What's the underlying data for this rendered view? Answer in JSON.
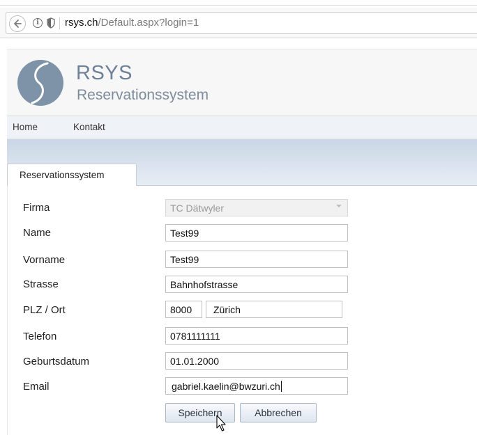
{
  "browser": {
    "url_host": "rsys.ch",
    "url_path": "/Default.aspx?login=1"
  },
  "brand": {
    "name": "RSYS",
    "subtitle": "Reservationssystem"
  },
  "menu": {
    "items": [
      {
        "label": "Home"
      },
      {
        "label": "Kontakt"
      }
    ]
  },
  "tab": {
    "label": "Reservationssystem"
  },
  "form": {
    "firma_label": "Firma",
    "firma_value": "TC Dätwyler",
    "name_label": "Name",
    "name_value": "Test99",
    "vorname_label": "Vorname",
    "vorname_value": "Test99",
    "strasse_label": "Strasse",
    "strasse_value": "Bahnhofstrasse",
    "plzort_label": "PLZ / Ort",
    "plz_value": "8000",
    "ort_value": "Zürich",
    "telefon_label": "Telefon",
    "telefon_value": "0781111111",
    "geburtsdatum_label": "Geburtsdatum",
    "geburtsdatum_value": "01.01.2000",
    "email_label": "Email",
    "email_value": "gabriel.kaelin@bwzuri.ch"
  },
  "buttons": {
    "save_label": "Speichern",
    "cancel_label": "Abbrechen"
  },
  "colors": {
    "brand_text": "#6f8196",
    "logo_circle": "#7f93a8",
    "menu_bg": "#eff3f8",
    "header_gradient_top": "#c9d6e6"
  },
  "icons": [
    "back-arrow-icon",
    "info-icon",
    "shield-icon",
    "logo-icon",
    "select-arrow-icon",
    "mouse-cursor-icon"
  ]
}
